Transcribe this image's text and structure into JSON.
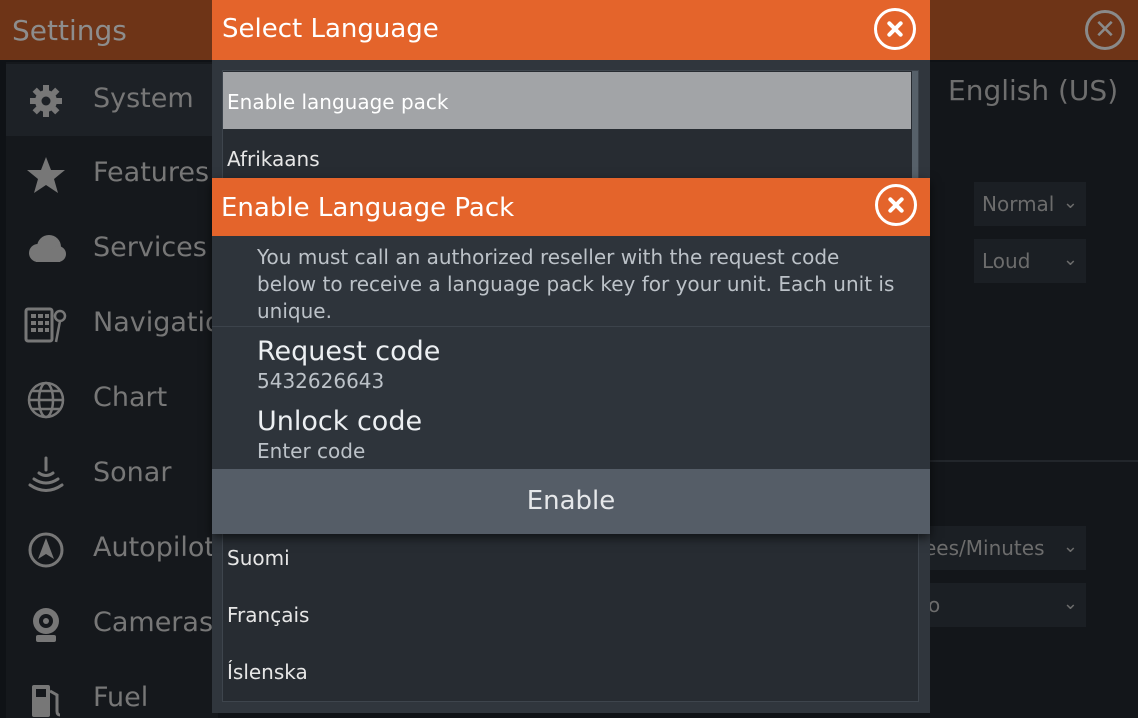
{
  "settings": {
    "title": "Settings",
    "sidebar": [
      {
        "label": "System",
        "icon": "gear-icon"
      },
      {
        "label": "Features",
        "icon": "star-icon"
      },
      {
        "label": "Services",
        "icon": "cloud-icon"
      },
      {
        "label": "Navigation",
        "icon": "navigation-calculator-icon"
      },
      {
        "label": "Chart",
        "icon": "globe-icon"
      },
      {
        "label": "Sonar",
        "icon": "sonar-icon"
      },
      {
        "label": "Autopilot",
        "icon": "autopilot-icon"
      },
      {
        "label": "Cameras",
        "icon": "camera-icon"
      },
      {
        "label": "Fuel",
        "icon": "fuel-pump-icon"
      }
    ],
    "right": {
      "language": "English (US)",
      "select1": "Normal",
      "select2": "Loud",
      "select3": "ees/Minutes",
      "select4": "o"
    }
  },
  "select_language": {
    "title": "Select Language",
    "items": [
      "Enable language pack",
      "Afrikaans",
      "Suomi",
      "Français",
      "Íslenska"
    ]
  },
  "enable_pack": {
    "title": "Enable Language Pack",
    "message": "You must call an authorized reseller with the request code below to receive a language pack key for your unit.  Each unit is unique.",
    "request_label": "Request code",
    "request_value": "5432626643",
    "unlock_label": "Unlock code",
    "unlock_placeholder": "Enter code",
    "enable_label": "Enable"
  },
  "colors": {
    "accent": "#e4642b",
    "dialog_bg": "#2e343b"
  }
}
